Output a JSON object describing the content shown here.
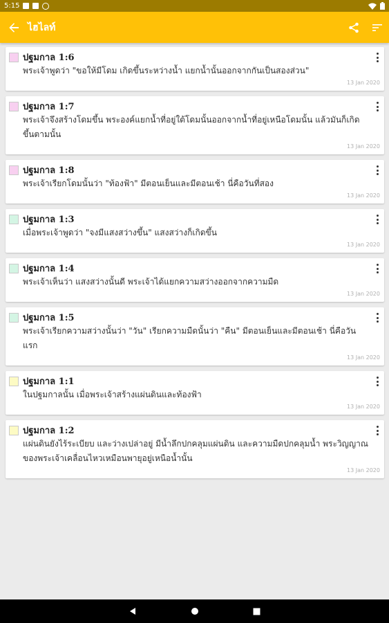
{
  "status_bar": {
    "time": "5:15"
  },
  "app_bar": {
    "title": "ไฮไลท์",
    "color": "#ffc107",
    "back_icon": "arrow-left-icon",
    "share_icon": "share-icon",
    "sort_icon": "sort-icon"
  },
  "highlights": [
    {
      "ref": "ปฐมกาล 1:6",
      "text": "พระเจ้าพูดว่า \"ขอให้มีโดม เกิดขึ้นระหว่างน้ำ แยกน้ำนั้นออกจากกันเป็นสองส่วน\"",
      "date": "13 Jan 2020",
      "color": "#f8d0f0"
    },
    {
      "ref": "ปฐมกาล 1:7",
      "text": "พระเจ้าจึงสร้างโดมขึ้น พระองค์แยกน้ำที่อยู่ใต้โดมนั้นออกจากน้ำที่อยู่เหนือโดมนั้น แล้วมันก็เกิดขึ้นตามนั้น",
      "date": "13 Jan 2020",
      "color": "#f8d0f0"
    },
    {
      "ref": "ปฐมกาล 1:8",
      "text": "พระเจ้าเรียกโดมนั้นว่า \"ท้องฟ้า\" มีตอนเย็นและมีตอนเช้า นี่คือวันที่สอง",
      "date": "13 Jan 2020",
      "color": "#f8d0f0"
    },
    {
      "ref": "ปฐมกาล 1:3",
      "text": "เมื่อพระเจ้าพูดว่า \"จงมีแสงสว่างขึ้น\" แสงสว่างก็เกิดขึ้น",
      "date": "13 Jan 2020",
      "color": "#d4f5e4"
    },
    {
      "ref": "ปฐมกาล 1:4",
      "text": "พระเจ้าเห็นว่า แสงสว่างนั้นดี พระเจ้าได้แยกความสว่างออกจากความมืด",
      "date": "13 Jan 2020",
      "color": "#d4f5e4"
    },
    {
      "ref": "ปฐมกาล 1:5",
      "text": "พระเจ้าเรียกความสว่างนั้นว่า \"วัน\" เรียกความมืดนั้นว่า \"คืน\" มีตอนเย็นและมีตอนเช้า นี่คือวันแรก",
      "date": "13 Jan 2020",
      "color": "#d4f5e4"
    },
    {
      "ref": "ปฐมกาล 1:1",
      "text": "ในปฐมกาลนั้น เมื่อพระเจ้าสร้างแผ่นดินและท้องฟ้า",
      "date": "13 Jan 2020",
      "color": "#fdfbc4"
    },
    {
      "ref": "ปฐมกาล 1:2",
      "text": "แผ่นดินยังไร้ระเบียบ และว่างเปล่าอยู่ มีน้ำลึกปกคลุมแผ่นดิน และความมืดปกคลุมน้ำ พระวิญญาณของพระเจ้าเคลื่อนไหวเหมือนพายุอยู่เหนือน้ำนั้น",
      "date": "13 Jan 2020",
      "color": "#fdfbc4"
    }
  ]
}
